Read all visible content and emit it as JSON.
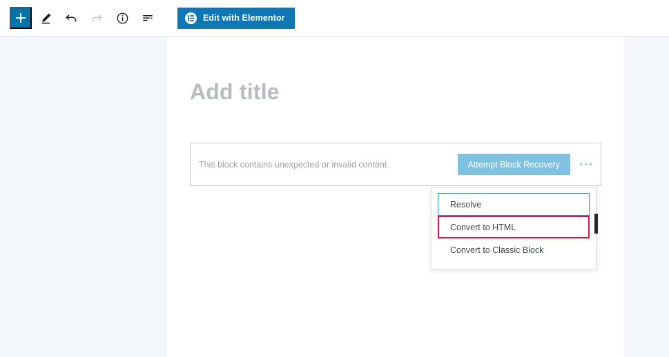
{
  "toolbar": {
    "add_block_label": "+",
    "add_block_title": "Add block",
    "icons": [
      {
        "name": "pencil-icon",
        "label": "Edit"
      },
      {
        "name": "undo-icon",
        "label": "Undo"
      },
      {
        "name": "redo-icon",
        "label": "Redo"
      },
      {
        "name": "info-icon",
        "label": "Content structure"
      },
      {
        "name": "outline-icon",
        "label": "Block navigation"
      }
    ],
    "elementor_button_label": "Edit with Elementor",
    "elementor_logo_letter": "E",
    "accent_color": "#0073aa",
    "elementor_button_color": "#0f77b5"
  },
  "editor": {
    "title_placeholder": "Add title",
    "block": {
      "warning_text": "This block contains unexpected or invalid content.",
      "recovery_button_label": "Attempt Block Recovery",
      "recovery_button_color": "#7ec2e2",
      "more_options_label": "More options"
    },
    "dropdown": {
      "items": [
        {
          "label": "Resolve",
          "state": "focused"
        },
        {
          "label": "Convert to HTML",
          "state": "highlighted"
        },
        {
          "label": "Convert to Classic Block",
          "state": "default"
        }
      ],
      "focus_ring_color": "#2e8fc9",
      "highlight_color": "#e0153f"
    }
  }
}
